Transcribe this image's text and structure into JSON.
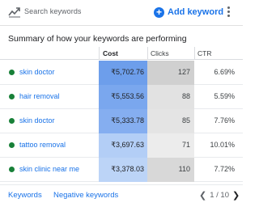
{
  "header": {
    "title": "Search keywords",
    "add_label": "Add keyword",
    "accent": "#1a73e8"
  },
  "summary": "Summary of how your keywords are performing",
  "table": {
    "columns": [
      "",
      "Cost",
      "Clicks",
      "CTR"
    ],
    "rows": [
      {
        "keyword": "skin doctor",
        "cost": "₹5,702.76",
        "clicks": "127",
        "ctr": "6.69%",
        "cost_color": "#6d9eeb",
        "clicks_color": "#d0d0d0"
      },
      {
        "keyword": "hair removal",
        "cost": "₹5,553.56",
        "clicks": "88",
        "ctr": "5.59%",
        "cost_color": "#7aa7ee",
        "clicks_color": "#e2e2e2"
      },
      {
        "keyword": "skin doctor",
        "cost": "₹5,333.78",
        "clicks": "85",
        "ctr": "7.76%",
        "cost_color": "#85aef0",
        "clicks_color": "#e4e4e4"
      },
      {
        "keyword": "tattoo removal",
        "cost": "₹3,697.63",
        "clicks": "71",
        "ctr": "10.01%",
        "cost_color": "#b3cef6",
        "clicks_color": "#ececec"
      },
      {
        "keyword": "skin clinic near me",
        "cost": "₹3,378.03",
        "clicks": "110",
        "ctr": "7.72%",
        "cost_color": "#bcd4f7",
        "clicks_color": "#d8d8d8"
      }
    ],
    "status_color": "#188038"
  },
  "footer": {
    "keywords_link": "Keywords",
    "negative_link": "Negative keywords",
    "page_text": "1 / 10"
  }
}
